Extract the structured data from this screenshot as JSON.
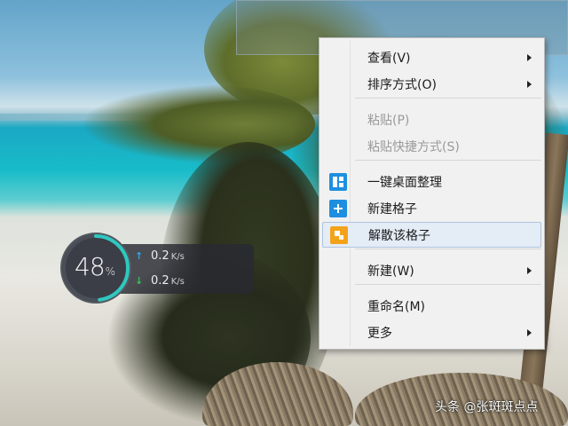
{
  "colors": {
    "menu_background": "#f1f1f1",
    "highlight": "#e4ecf6",
    "disabled_text": "#9a9a9a",
    "icon_blue": "#1e8fe0",
    "icon_orange": "#f3a31b",
    "upload_arrow": "#34a7e8",
    "download_arrow": "#3fbf59",
    "gauge_ring": "#2fc8c0"
  },
  "network_widget": {
    "percent": "48",
    "percent_sign": "%",
    "usage_fraction": 0.48,
    "upload_value": "0.2",
    "upload_unit": "K/s",
    "download_value": "0.2",
    "download_unit": "K/s",
    "upload_icon": "arrow-up-icon",
    "download_icon": "arrow-down-icon"
  },
  "context_menu": {
    "items": [
      {
        "label": "查看(V)",
        "submenu": true,
        "enabled": true
      },
      {
        "label": "排序方式(O)",
        "submenu": true,
        "enabled": true
      },
      {
        "label": "粘贴(P)",
        "submenu": false,
        "enabled": false
      },
      {
        "label": "粘贴快捷方式(S)",
        "submenu": false,
        "enabled": false
      },
      {
        "label": "一键桌面整理",
        "submenu": false,
        "enabled": true,
        "icon": "desktop-organize-icon"
      },
      {
        "label": "新建格子",
        "submenu": false,
        "enabled": true,
        "icon": "plus-icon"
      },
      {
        "label": "解散该格子",
        "submenu": false,
        "enabled": true,
        "icon": "dissolve-grid-icon",
        "highlighted": true
      },
      {
        "label": "新建(W)",
        "submenu": true,
        "enabled": true
      },
      {
        "label": "重命名(M)",
        "submenu": false,
        "enabled": true
      },
      {
        "label": "更多",
        "submenu": true,
        "enabled": true
      }
    ]
  },
  "watermark": {
    "text": "头条 @张斑斑点点"
  }
}
